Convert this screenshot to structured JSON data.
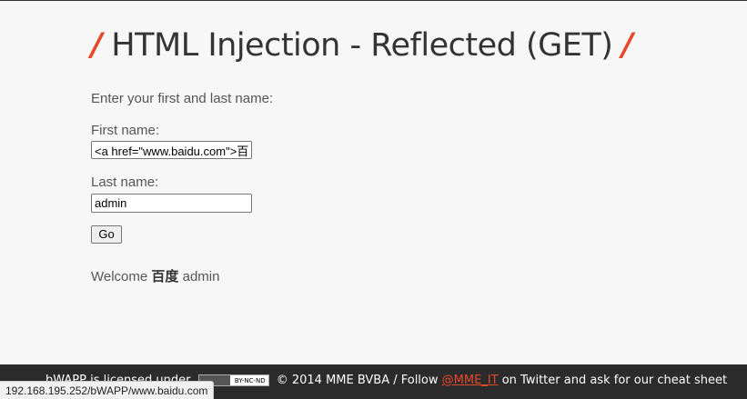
{
  "title": {
    "slash_left": "/",
    "text": "HTML Injection - Reflected (GET)",
    "slash_right": "/",
    "accent_color": "#e8482a"
  },
  "form": {
    "intro": "Enter your first and last name:",
    "first_name_label": "First name:",
    "first_name_value": "<a href=\"www.baidu.com\">百度</a>",
    "last_name_label": "Last name:",
    "last_name_value": "admin",
    "go_label": "Go"
  },
  "result": {
    "welcome": "Welcome",
    "link_text": "百度",
    "last_name": "admin"
  },
  "footer": {
    "prefix": "bWAPP is licensed under",
    "license_badge": "BY-NC-ND",
    "copyright": "© 2014 MME BVBA / Follow",
    "twitter_handle": "@MME_IT",
    "suffix": "on Twitter and ask for our cheat sheet"
  },
  "status_bar": {
    "url": "192.168.195.252/bWAPP/www.baidu.com"
  }
}
